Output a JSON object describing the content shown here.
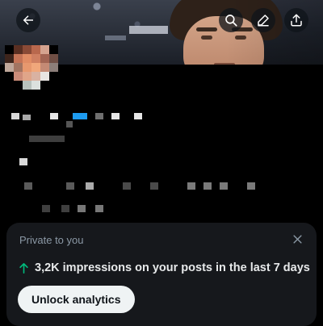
{
  "header": {
    "back_icon": "arrow-left-icon",
    "actions": [
      {
        "icon": "search-icon"
      },
      {
        "icon": "edit-icon"
      },
      {
        "icon": "share-icon"
      }
    ]
  },
  "analytics_card": {
    "label": "Private to you",
    "close_icon": "close-icon",
    "trend_icon": "arrow-up-icon",
    "trend_color": "#00ba7c",
    "headline": "3,2K impressions on your posts in the last 7 days",
    "button_label": "Unlock analytics"
  },
  "colors": {
    "accent": "#1d9bf0",
    "background": "#000000",
    "card": "#16181c"
  }
}
